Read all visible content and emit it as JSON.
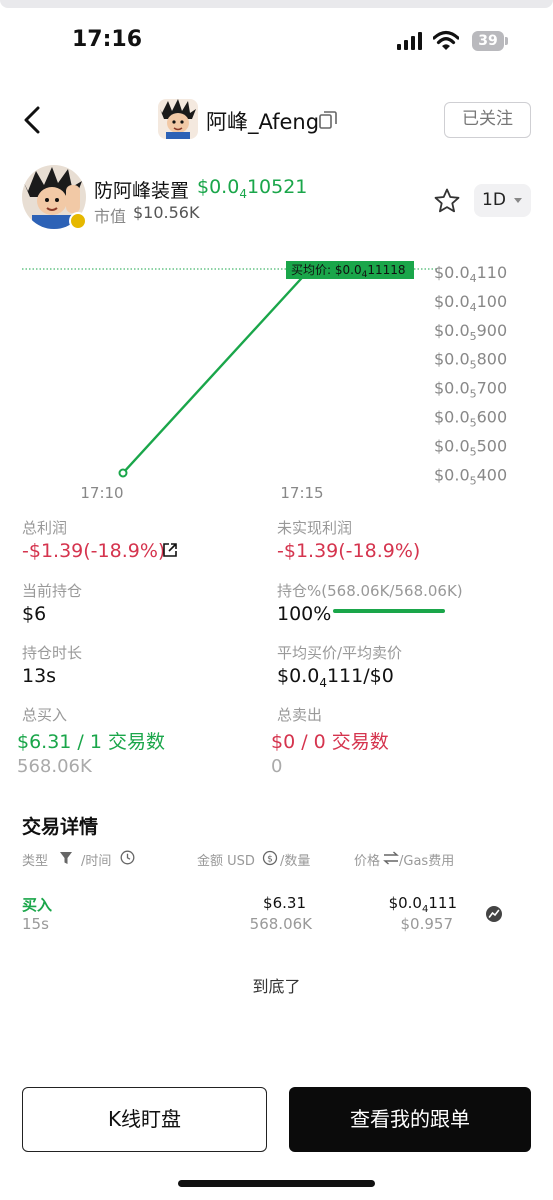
{
  "status_bar": {
    "time": "17:16",
    "battery": "39"
  },
  "header": {
    "username": "阿峰_Afeng",
    "follow_label": "已关注"
  },
  "token": {
    "name": "防阿峰装置",
    "price_prefix": "$0.0",
    "price_sub": "4",
    "price_rest": "10521",
    "mcap_label": "市值",
    "mcap_value": "$10.56K",
    "interval": "1D"
  },
  "chart_data": {
    "type": "line",
    "x": [
      "17:10",
      "17:15"
    ],
    "x_ticks": [
      "17:10",
      "17:15"
    ],
    "y_ticks": [
      {
        "p": "$0.0",
        "s": "4",
        "r": "110"
      },
      {
        "p": "$0.0",
        "s": "4",
        "r": "100"
      },
      {
        "p": "$0.0",
        "s": "5",
        "r": "900"
      },
      {
        "p": "$0.0",
        "s": "5",
        "r": "800"
      },
      {
        "p": "$0.0",
        "s": "5",
        "r": "700"
      },
      {
        "p": "$0.0",
        "s": "5",
        "r": "600"
      },
      {
        "p": "$0.0",
        "s": "5",
        "r": "500"
      },
      {
        "p": "$0.0",
        "s": "5",
        "r": "400"
      }
    ],
    "annotation": {
      "label": "买均价: $0.0",
      "sub": "4",
      "rest": "11118"
    },
    "colors": {
      "line": "#1aa64a",
      "tag": "#1aa64a"
    }
  },
  "stats": {
    "total_profit_label": "总利润",
    "total_profit_value": "-$1.39(-18.9%)",
    "unrealized_label": "未实现利润",
    "unrealized_value": "-$1.39(-18.9%)",
    "holding_label": "当前持仓",
    "holding_value": "$6",
    "position_label": "持仓%(568.06K/568.06K)",
    "position_value": "100%",
    "position_fraction": 1.0,
    "duration_label": "持仓时长",
    "duration_value": "13s",
    "avg_label": "平均买价/平均卖价",
    "avg_prefix": "$0.0",
    "avg_sub": "4",
    "avg_rest": "111/$0",
    "total_buy_label": "总买入",
    "total_buy_value": "$6.31 / 1 交易数",
    "total_buy_qty": "568.06K",
    "total_sell_label": "总卖出",
    "total_sell_value": "$0 / 0 交易数",
    "total_sell_qty": "0"
  },
  "trades": {
    "title": "交易详情",
    "headers": {
      "type": "类型",
      "time": "/时间",
      "amount": "金额 USD",
      "qty": "/数量",
      "price": "价格",
      "gas": "/Gas费用"
    },
    "rows": [
      {
        "type": "买入",
        "time": "15s",
        "amount": "$6.31",
        "qty": "568.06K",
        "price_prefix": "$0.0",
        "price_sub": "4",
        "price_rest": "111",
        "gas": "$0.957"
      }
    ],
    "end_text": "到底了"
  },
  "actions": {
    "kline_label": "K线盯盘",
    "copy_label": "查看我的跟单"
  },
  "colors": {
    "green": "#1aa64a",
    "red": "#d5344e",
    "dark": "#0b0b0b"
  }
}
